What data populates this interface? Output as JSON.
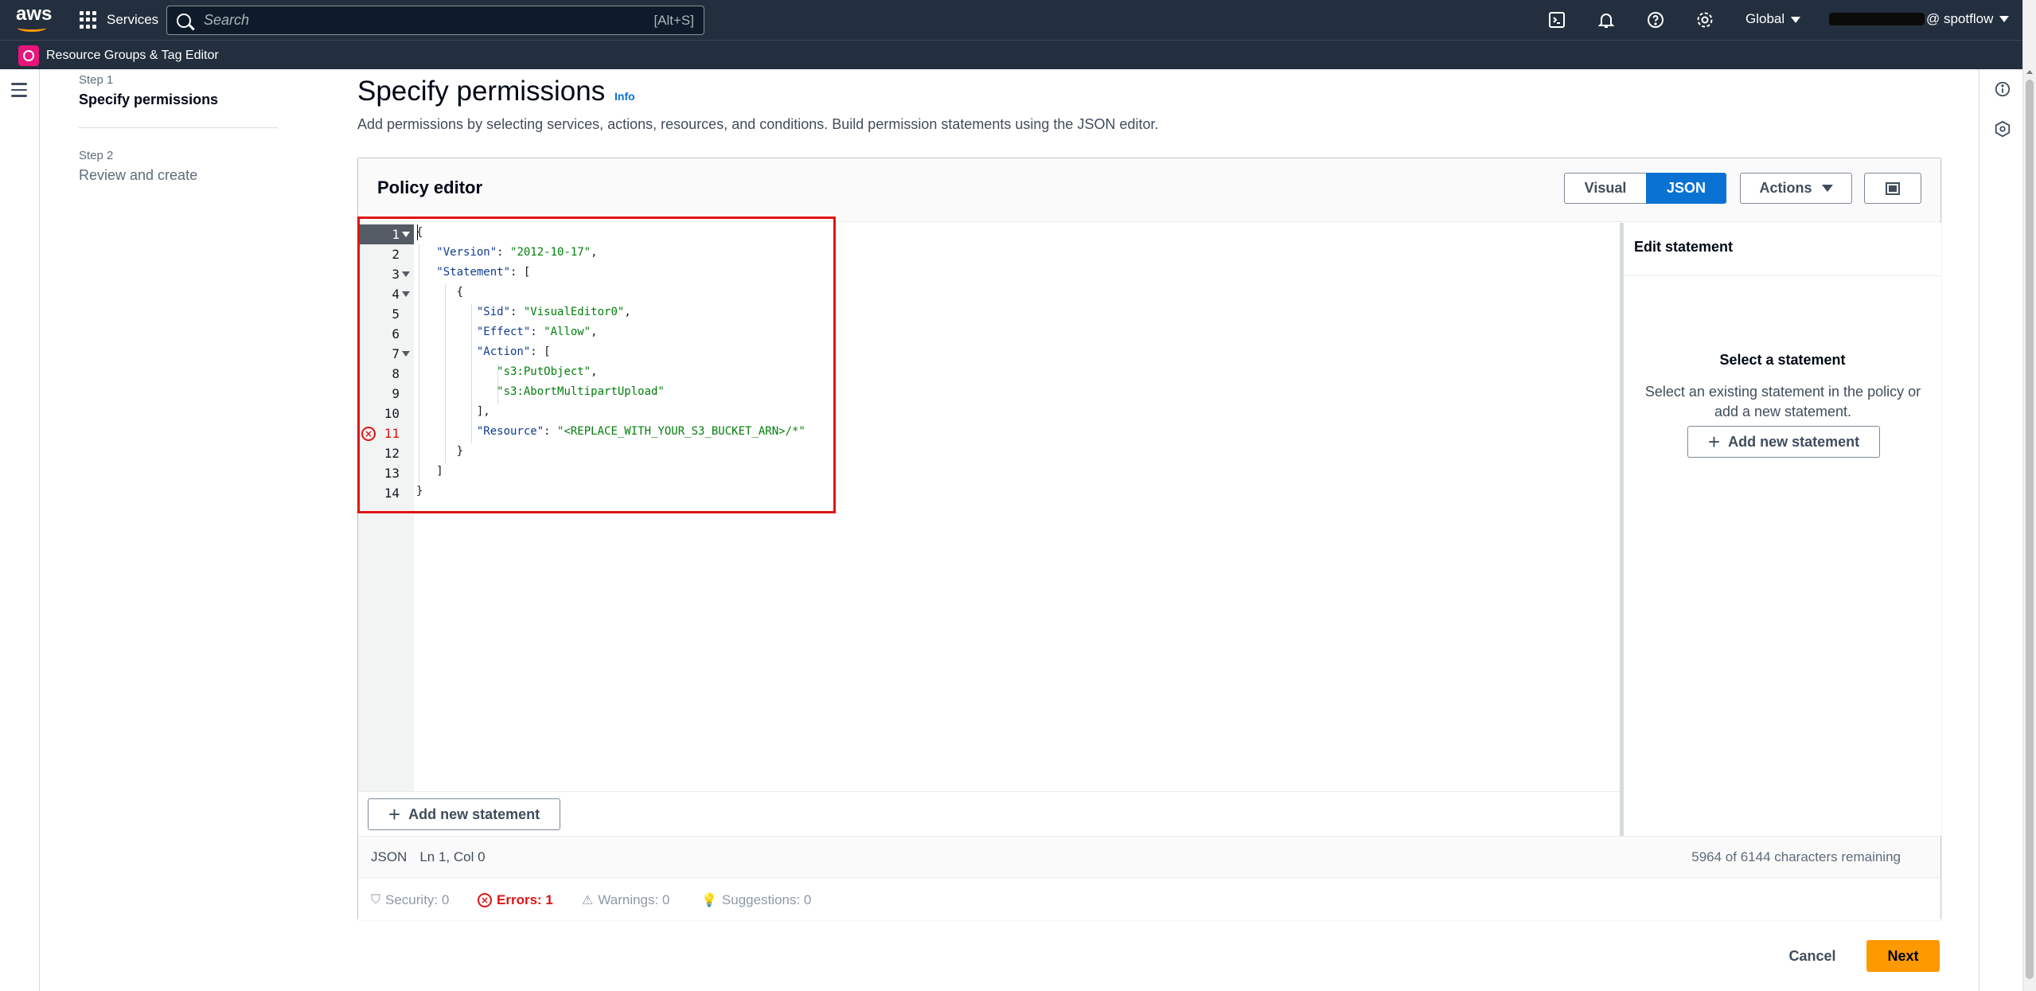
{
  "nav": {
    "logo": "aws",
    "services_label": "Services",
    "search_placeholder": "Search",
    "search_shortcut": "[Alt+S]",
    "region": "Global",
    "account": "@ spotflow"
  },
  "subnav": {
    "service_name": "Resource Groups & Tag Editor"
  },
  "steps": [
    {
      "label": "Step 1",
      "title": "Specify permissions"
    },
    {
      "label": "Step 2",
      "title": "Review and create"
    }
  ],
  "header": {
    "title": "Specify permissions",
    "info": "Info",
    "description": "Add permissions by selecting services, actions, resources, and conditions. Build permission statements using the JSON editor."
  },
  "editor": {
    "title": "Policy editor",
    "visual_label": "Visual",
    "json_label": "JSON",
    "actions_label": "Actions",
    "line_numbers": [
      "1",
      "2",
      "3",
      "4",
      "5",
      "6",
      "7",
      "8",
      "9",
      "10",
      "11",
      "12",
      "13",
      "14"
    ],
    "code": {
      "l1": "{",
      "version_key": "\"Version\"",
      "version_val": "\"2012-10-17\"",
      "statement_key": "\"Statement\"",
      "sid_key": "\"Sid\"",
      "sid_val": "\"VisualEditor0\"",
      "effect_key": "\"Effect\"",
      "effect_val": "\"Allow\"",
      "action_key": "\"Action\"",
      "action_1": "\"s3:PutObject\"",
      "action_2": "\"s3:AbortMultipartUpload\"",
      "resource_key": "\"Resource\"",
      "resource_val": "\"<REPLACE_WITH_YOUR_S3_BUCKET_ARN>/*\""
    },
    "error_line": "11",
    "add_statement_label": "Add new statement",
    "status_mode": "JSON",
    "status_position": "Ln 1, Col 0",
    "chars_remaining": "5964 of 6144 characters remaining",
    "validation": {
      "security": "Security: 0",
      "errors": "Errors: 1",
      "warnings": "Warnings: 0",
      "suggestions": "Suggestions: 0"
    }
  },
  "side_panel": {
    "title": "Edit statement",
    "empty_title": "Select a statement",
    "empty_desc": "Select an existing statement in the policy or add a new statement.",
    "add_label": "Add new statement"
  },
  "footer": {
    "cancel_label": "Cancel",
    "next_label": "Next"
  },
  "colors": {
    "nav_bg": "#232f3e",
    "primary": "#0972d3",
    "next_button": "#ff9900",
    "error": "#d91515",
    "highlight": "#e01414"
  }
}
